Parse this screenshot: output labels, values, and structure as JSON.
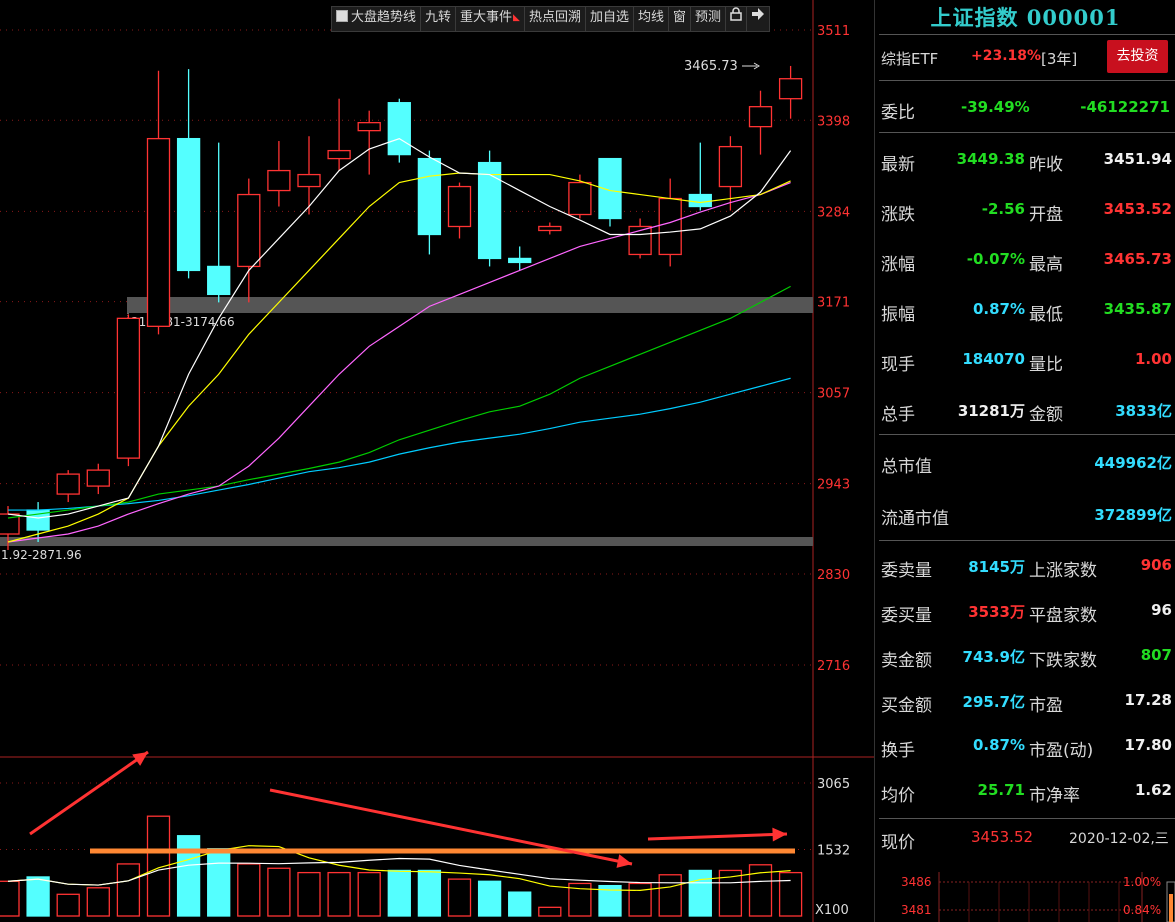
{
  "toolbar": {
    "items": [
      "大盘趋势线",
      "九转",
      "重大事件",
      "热点回溯",
      "加自选",
      "均线",
      "窗",
      "预测"
    ],
    "lock_icon": "lock-icon",
    "arrow_icon": "arrow-right-icon"
  },
  "chart": {
    "price_axis": [
      "3511",
      "3398",
      "3284",
      "3171",
      "3057",
      "2943",
      "2830",
      "2716"
    ],
    "volume_axis": [
      "3065",
      "1532",
      "X100"
    ],
    "high_label": "3465.73",
    "band_upper_label": "3152.81-3174.66",
    "band_lower_label": "1.92-2871.96",
    "colors": {
      "up": "#ff3333",
      "down": "#54ffff",
      "ma5": "#ffffff",
      "ma10": "#ffff00",
      "ma20": "#ff66ff",
      "ma60": "#00cc00",
      "ma120": "#00ccff",
      "band": "#555555",
      "arrow": "#ff3333",
      "orange": "#ff8833"
    }
  },
  "chart_data": {
    "type": "candlestick",
    "price_range": [
      2716,
      3511
    ],
    "candles": [
      {
        "o": 2880,
        "c": 2905,
        "h": 2915,
        "l": 2860,
        "v": 800
      },
      {
        "o": 2910,
        "c": 2885,
        "h": 2920,
        "l": 2870,
        "v": 900
      },
      {
        "o": 2930,
        "c": 2955,
        "h": 2960,
        "l": 2920,
        "v": 500
      },
      {
        "o": 2940,
        "c": 2960,
        "h": 2968,
        "l": 2930,
        "v": 650
      },
      {
        "o": 2975,
        "c": 3150,
        "h": 3155,
        "l": 2965,
        "v": 1200
      },
      {
        "o": 3140,
        "c": 3375,
        "h": 3460,
        "l": 3130,
        "v": 2300
      },
      {
        "o": 3375,
        "c": 3210,
        "h": 3462,
        "l": 3200,
        "v": 1850
      },
      {
        "o": 3215,
        "c": 3180,
        "h": 3370,
        "l": 3170,
        "v": 1550
      },
      {
        "o": 3215,
        "c": 3305,
        "h": 3325,
        "l": 3170,
        "v": 1200
      },
      {
        "o": 3310,
        "c": 3335,
        "h": 3372,
        "l": 3290,
        "v": 1100
      },
      {
        "o": 3315,
        "c": 3330,
        "h": 3378,
        "l": 3280,
        "v": 1000
      },
      {
        "o": 3350,
        "c": 3360,
        "h": 3425,
        "l": 3335,
        "v": 1000
      },
      {
        "o": 3385,
        "c": 3395,
        "h": 3410,
        "l": 3330,
        "v": 1000
      },
      {
        "o": 3420,
        "c": 3355,
        "h": 3425,
        "l": 3345,
        "v": 1050
      },
      {
        "o": 3350,
        "c": 3255,
        "h": 3360,
        "l": 3230,
        "v": 1050
      },
      {
        "o": 3265,
        "c": 3315,
        "h": 3320,
        "l": 3250,
        "v": 850
      },
      {
        "o": 3345,
        "c": 3225,
        "h": 3360,
        "l": 3215,
        "v": 800
      },
      {
        "o": 3225,
        "c": 3220,
        "h": 3240,
        "l": 3210,
        "v": 550
      },
      {
        "o": 3260,
        "c": 3265,
        "h": 3270,
        "l": 3255,
        "v": 200
      },
      {
        "o": 3280,
        "c": 3320,
        "h": 3330,
        "l": 3275,
        "v": 750
      },
      {
        "o": 3350,
        "c": 3275,
        "h": 3350,
        "l": 3265,
        "v": 700
      },
      {
        "o": 3230,
        "c": 3265,
        "h": 3275,
        "l": 3225,
        "v": 750
      },
      {
        "o": 3230,
        "c": 3300,
        "h": 3325,
        "l": 3215,
        "v": 950
      },
      {
        "o": 3305,
        "c": 3290,
        "h": 3370,
        "l": 3285,
        "v": 1050
      },
      {
        "o": 3315,
        "c": 3365,
        "h": 3378,
        "l": 3285,
        "v": 1050
      },
      {
        "o": 3390,
        "c": 3415,
        "h": 3435,
        "l": 3355,
        "v": 1180
      },
      {
        "o": 3425,
        "c": 3450,
        "h": 3466,
        "l": 3400,
        "v": 1000
      }
    ],
    "ma5": [
      2905,
      2900,
      2905,
      2915,
      2925,
      2990,
      3080,
      3150,
      3210,
      3250,
      3290,
      3335,
      3362,
      3375,
      3352,
      3332,
      3330,
      3310,
      3290,
      3273,
      3255,
      3255,
      3258,
      3262,
      3278,
      3308,
      3360
    ],
    "ma10": [
      2870,
      2880,
      2890,
      2905,
      2925,
      2990,
      3040,
      3080,
      3130,
      3170,
      3210,
      3250,
      3290,
      3320,
      3328,
      3332,
      3330,
      3330,
      3330,
      3322,
      3310,
      3305,
      3300,
      3295,
      3300,
      3305,
      3322
    ],
    "ma20": [
      2870,
      2875,
      2880,
      2890,
      2905,
      2918,
      2930,
      2940,
      2965,
      3000,
      3040,
      3080,
      3115,
      3140,
      3165,
      3180,
      3195,
      3210,
      3225,
      3240,
      3250,
      3260,
      3270,
      3283,
      3295,
      3305,
      3320
    ],
    "ma60": [
      2900,
      2905,
      2910,
      2915,
      2920,
      2930,
      2935,
      2940,
      2948,
      2955,
      2962,
      2970,
      2982,
      2998,
      3010,
      3022,
      3033,
      3040,
      3055,
      3075,
      3090,
      3105,
      3120,
      3135,
      3150,
      3170,
      3190
    ],
    "ma120": [
      2910,
      2910,
      2912,
      2915,
      2918,
      2922,
      2928,
      2935,
      2942,
      2950,
      2958,
      2963,
      2970,
      2980,
      2988,
      2995,
      3000,
      3005,
      3012,
      3020,
      3025,
      3030,
      3037,
      3045,
      3055,
      3065,
      3075
    ],
    "volume_range": [
      0,
      3065
    ]
  },
  "panel": {
    "title": "上证指数 000001",
    "etf": {
      "label": "综指ETF",
      "change": "+23.18%",
      "period": "[3年]",
      "button": "去投资"
    },
    "weibi": {
      "label": "委比",
      "pct": "-39.49%",
      "value": "-46122271"
    },
    "rows1": [
      {
        "l1": "最新",
        "v1": "3449.38",
        "c1": "g",
        "l2": "昨收",
        "v2": "3451.94",
        "c2": "w"
      },
      {
        "l1": "涨跌",
        "v1": "-2.56",
        "c1": "g",
        "l2": "开盘",
        "v2": "3453.52",
        "c2": "r"
      },
      {
        "l1": "涨幅",
        "v1": "-0.07%",
        "c1": "g",
        "l2": "最高",
        "v2": "3465.73",
        "c2": "r"
      },
      {
        "l1": "振幅",
        "v1": "0.87%",
        "c1": "c",
        "l2": "最低",
        "v2": "3435.87",
        "c2": "g"
      },
      {
        "l1": "现手",
        "v1": "184070",
        "c1": "c",
        "l2": "量比",
        "v2": "1.00",
        "c2": "r"
      },
      {
        "l1": "总手",
        "v1": "31281万",
        "c1": "w",
        "l2": "金额",
        "v2": "3833亿",
        "c2": "c"
      }
    ],
    "caps": [
      {
        "l": "总市值",
        "v": "449962亿"
      },
      {
        "l": "流通市值",
        "v": "372899亿"
      }
    ],
    "rows2": [
      {
        "l1": "委卖量",
        "v1": "8145万",
        "c1": "c",
        "l2": "上涨家数",
        "v2": "906",
        "c2": "r"
      },
      {
        "l1": "委买量",
        "v1": "3533万",
        "c1": "r",
        "l2": "平盘家数",
        "v2": "96",
        "c2": "w"
      },
      {
        "l1": "卖金额",
        "v1": "743.9亿",
        "c1": "c",
        "l2": "下跌家数",
        "v2": "807",
        "c2": "g"
      },
      {
        "l1": "买金额",
        "v1": "295.7亿",
        "c1": "c",
        "l2": "市盈",
        "v2": "17.28",
        "c2": "w"
      },
      {
        "l1": "换手",
        "v1": "0.87%",
        "c1": "c",
        "l2": "市盈(动)",
        "v2": "17.80",
        "c2": "w"
      },
      {
        "l1": "均价",
        "v1": "25.71",
        "c1": "g",
        "l2": "市净率",
        "v2": "1.62",
        "c2": "w"
      }
    ],
    "current": {
      "label": "现价",
      "value": "3453.52",
      "date": "2020-12-02,三"
    },
    "mini": {
      "y1": "3486",
      "y2": "3481",
      "p1": "1.00%",
      "p2": "0.84%"
    }
  }
}
